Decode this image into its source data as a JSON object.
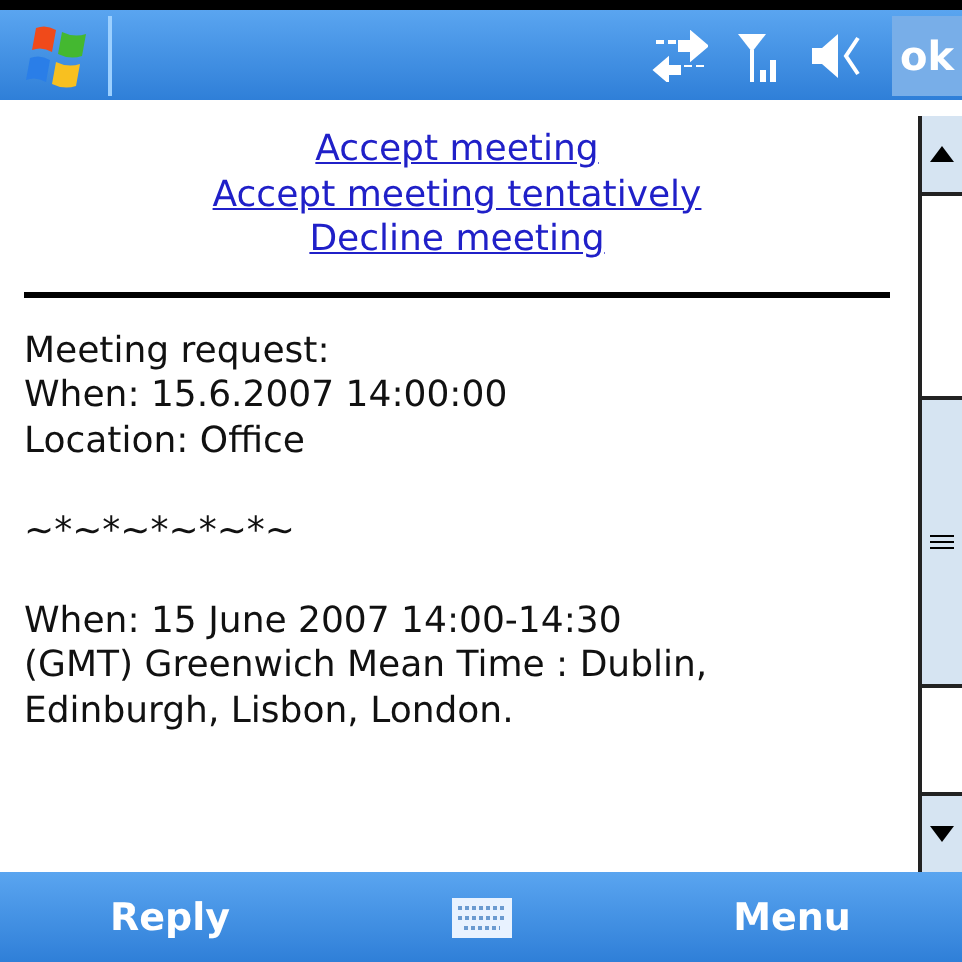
{
  "title_bar": {
    "ok_button": "ok"
  },
  "actions": [
    "Accept meeting",
    "Accept meeting tentatively",
    "Decline meeting"
  ],
  "paragraphs": [
    {
      "lines": [
        "Meeting request:",
        "When: 15.6.2007 14:00:00",
        "Location: Office"
      ]
    },
    {
      "lines": [
        "~*~*~*~*~*~"
      ]
    },
    {
      "lines": [
        "When: 15 June 2007 14:00-14:30",
        "(GMT) Greenwich Mean Time : Dublin,",
        "Edinburgh, Lisbon, London."
      ]
    }
  ],
  "softkeys": {
    "left": "Reply",
    "right": "Menu"
  }
}
